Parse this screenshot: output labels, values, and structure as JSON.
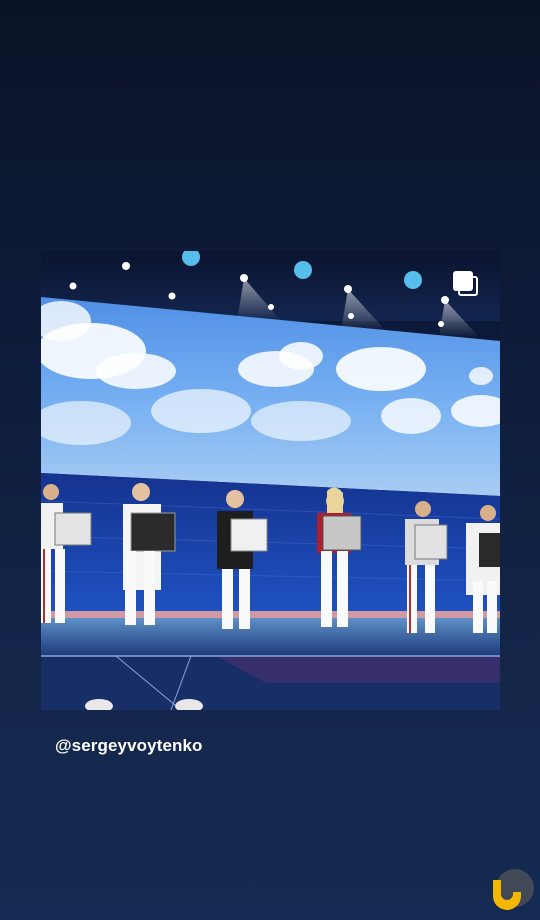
{
  "story": {
    "mention": "@sergeyvoytenko",
    "icons": {
      "multi_post": "carousel-stack-icon",
      "badge": "app-badge-icon"
    },
    "colors": {
      "background_top": "#0a1226",
      "background_bottom": "#142a52",
      "badge_yellow": "#f5b800",
      "badge_grey": "#4a4f57"
    }
  }
}
